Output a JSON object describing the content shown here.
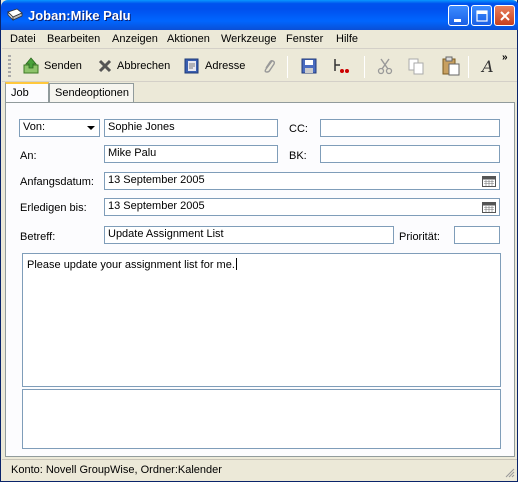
{
  "window": {
    "title": "Joban:Mike Palu"
  },
  "menu": [
    "Datei",
    "Bearbeiten",
    "Anzeigen",
    "Aktionen",
    "Werkzeuge",
    "Fenster",
    "Hilfe"
  ],
  "toolbar": {
    "send_label": "Senden",
    "cancel_label": "Abbrechen",
    "address_label": "Adresse",
    "overflow": "»"
  },
  "tabs": [
    "Job",
    "Sendeoptionen"
  ],
  "form": {
    "from_label": "Von:",
    "from_value": "Sophie Jones",
    "to_label": "An:",
    "to_value": "Mike Palu",
    "cc_label": "CC:",
    "cc_value": "",
    "bcc_label": "BK:",
    "bcc_value": "",
    "start_label": "Anfangsdatum:",
    "start_value": "13 September 2005",
    "due_label": "Erledigen bis:",
    "due_value": "13 September 2005",
    "subject_label": "Betreff:",
    "subject_value": "Update Assignment List",
    "priority_label": "Priorität:",
    "priority_value": "",
    "message": "Please update your assignment list for me."
  },
  "status": {
    "text": "Konto: Novell GroupWise,  Ordner:Kalender"
  }
}
